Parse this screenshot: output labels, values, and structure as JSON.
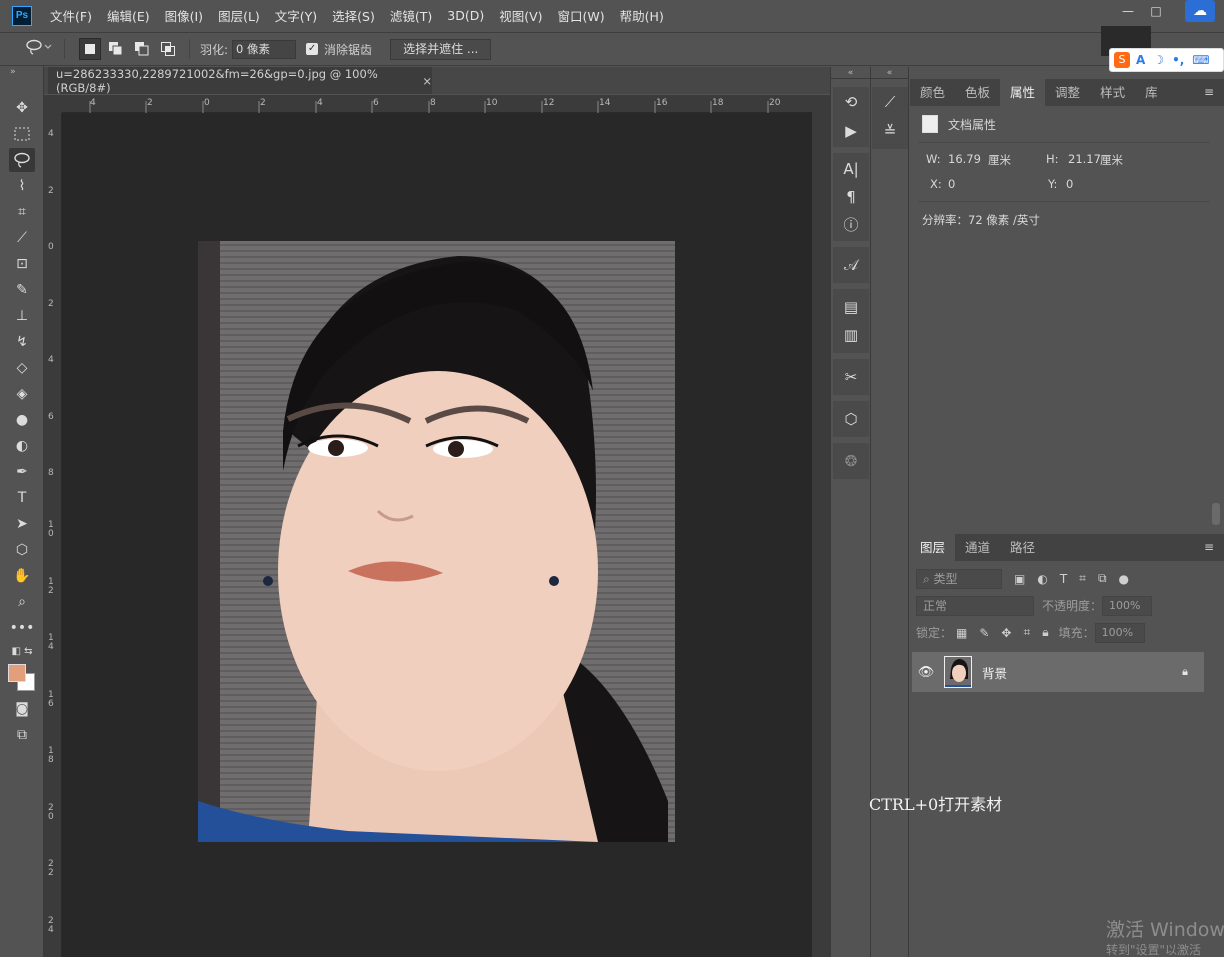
{
  "app": {
    "logo": "Ps"
  },
  "menu": [
    "文件(F)",
    "编辑(E)",
    "图像(I)",
    "图层(L)",
    "文字(Y)",
    "选择(S)",
    "滤镜(T)",
    "3D(D)",
    "视图(V)",
    "窗口(W)",
    "帮助(H)"
  ],
  "options": {
    "feather_label": "羽化:",
    "feather_value": "0 像素",
    "antialias_label": "消除锯齿",
    "select_mask_button": "选择并遮住 ..."
  },
  "document": {
    "tab_title": "u=286233330,2289721002&fm=26&gp=0.jpg @ 100%(RGB/8#)",
    "close_glyph": "×"
  },
  "rulers": {
    "top": [
      "4",
      "2",
      "0",
      "2",
      "4",
      "6",
      "8",
      "10",
      "12",
      "14",
      "16",
      "18",
      "20"
    ],
    "left": [
      "4",
      "2",
      "0",
      "2",
      "4",
      "6",
      "8",
      "1 0",
      "1 2",
      "1 4",
      "1 6",
      "1 8",
      "2 0",
      "2 2",
      "2 4"
    ]
  },
  "props_panel": {
    "tabs": [
      "颜色",
      "色板",
      "属性",
      "调整",
      "样式",
      "库"
    ],
    "active_tab": "属性",
    "header": "文档属性",
    "w_label": "W:",
    "w_value": "16.79",
    "w_unit": "厘米",
    "h_label": "H:",
    "h_value": "21.17",
    "h_unit": "厘米",
    "x_label": "X:",
    "x_value": "0",
    "y_label": "Y:",
    "y_value": "0",
    "resolution": "分辨率：72 像素 /英寸"
  },
  "layers_panel": {
    "tabs": [
      "图层",
      "通道",
      "路径"
    ],
    "active_tab": "图层",
    "filter_placeholder": "类型",
    "blend_mode": "正常",
    "opacity_label": "不透明度：",
    "opacity_value": "100%",
    "lock_label": "锁定：",
    "fill_label": "填充：",
    "fill_value": "100%",
    "layers": [
      {
        "name": "背景",
        "visible": true,
        "locked": true
      }
    ]
  },
  "colors": {
    "foreground": "#e39e7d",
    "background": "#ffffff"
  },
  "hint_text": "CTRL+0打开素材",
  "watermark": {
    "line1": "激活 Window",
    "line2": "转到\"设置\"以激活"
  }
}
